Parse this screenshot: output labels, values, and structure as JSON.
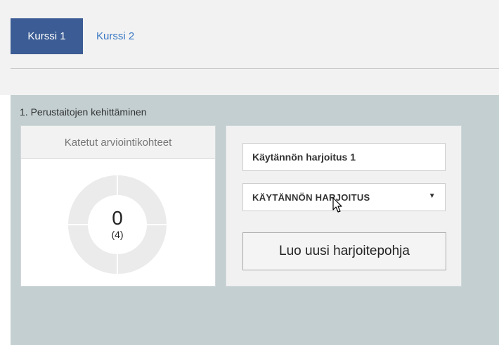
{
  "tabs": [
    {
      "label": "Kurssi 1",
      "active": true
    },
    {
      "label": "Kurssi 2",
      "active": false
    }
  ],
  "section": {
    "title": "1. Perustaitojen kehittäminen",
    "coverage_card": {
      "header": "Katetut arviointikohteet",
      "value": "0",
      "total": "(4)"
    },
    "form": {
      "name_value": "Käytännön harjoitus 1",
      "type_selected": "KÄYTÄNNÖN HARJOITUS",
      "create_label": "Luo uusi harjoitepohja"
    }
  },
  "colors": {
    "active_tab": "#3b5c94",
    "link": "#3b79c4",
    "section_bg": "#c3cfd1",
    "donut_ring": "#ebebeb"
  },
  "icons": {
    "select_arrow": "caret-down-icon",
    "cursor": "mouse-pointer-icon"
  }
}
